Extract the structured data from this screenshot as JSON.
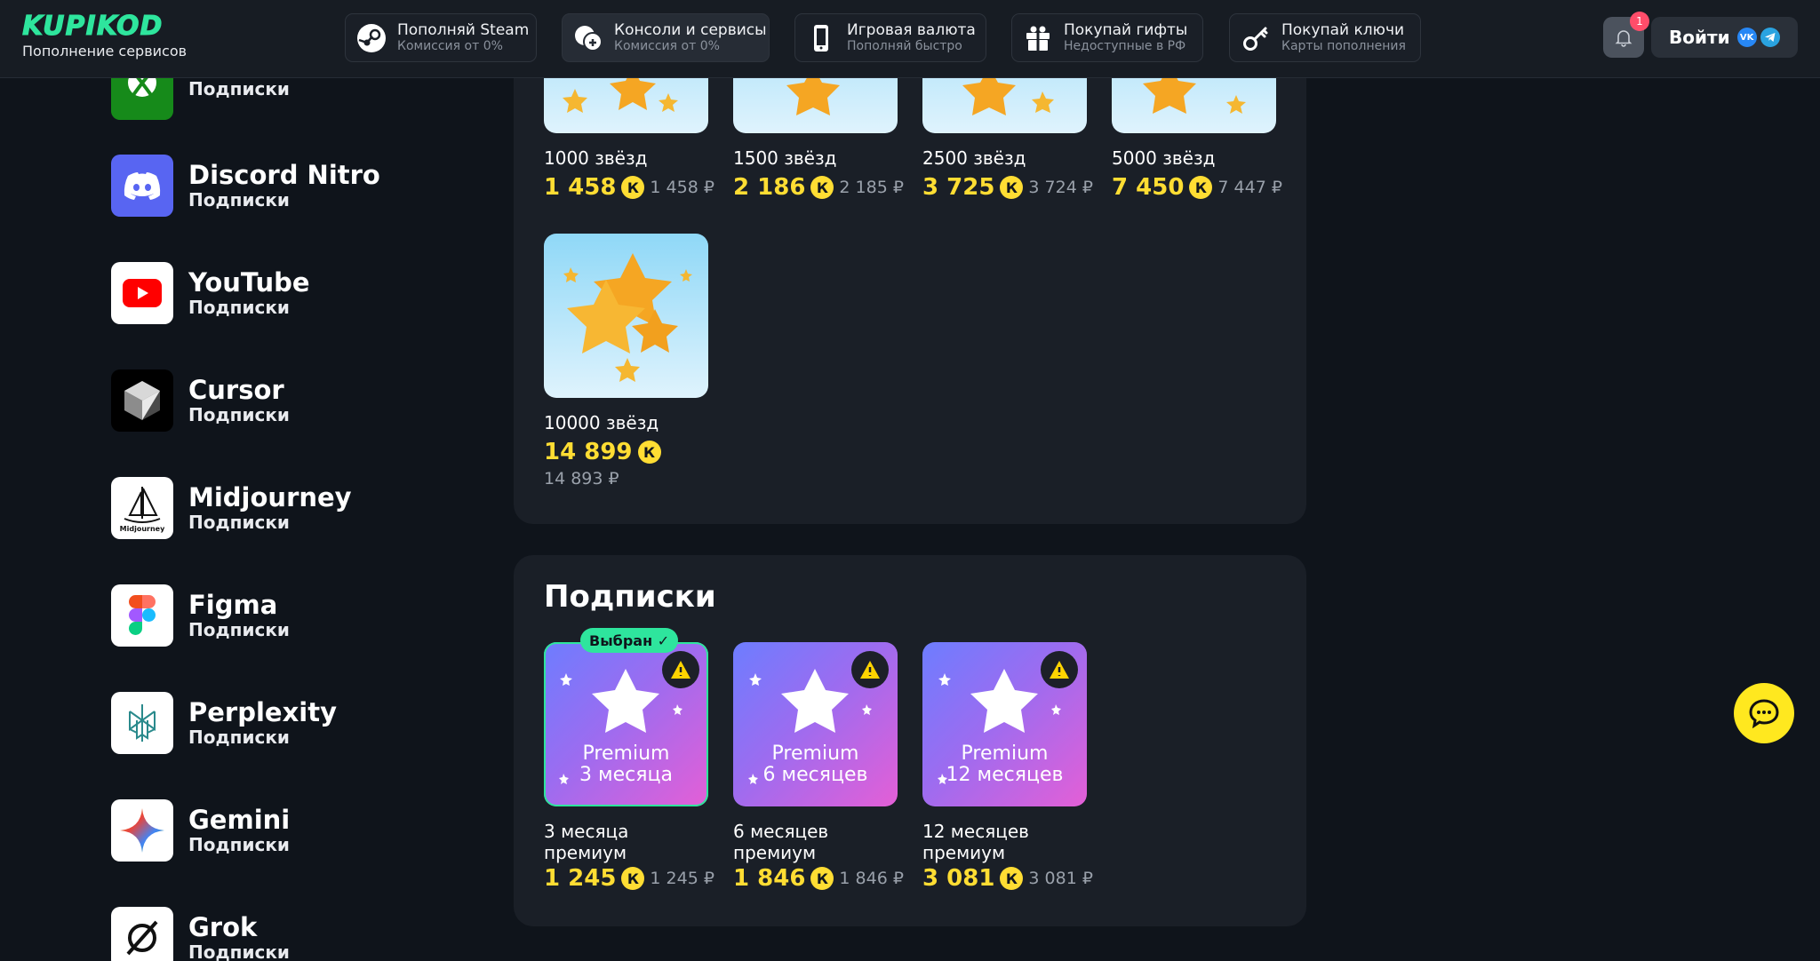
{
  "header": {
    "logo": "KUPIKOD",
    "logo_sub": "Пополнение сервисов",
    "nav": [
      {
        "title": "Пополняй Steam",
        "sub": "Комиссия от 0%",
        "icon": "steam-icon"
      },
      {
        "title": "Консоли и сервисы",
        "sub": "Комиссия от 0%",
        "icon": "console-icon"
      },
      {
        "title": "Игровая валюта",
        "sub": "Пополняй быстро",
        "icon": "phone-icon"
      },
      {
        "title": "Покупай гифты",
        "sub": "Недоступные в РФ",
        "icon": "gift-icon"
      },
      {
        "title": "Покупай ключи",
        "sub": "Карты пополнения",
        "icon": "key-icon"
      }
    ],
    "notifications": "1",
    "login_label": "Войти",
    "vk": "VK"
  },
  "sidebar": [
    {
      "title": "",
      "sub": "Подписки",
      "icon": "xbox-icon"
    },
    {
      "title": "Discord Nitro",
      "sub": "Подписки",
      "icon": "discord-icon"
    },
    {
      "title": "YouTube",
      "sub": "Подписки",
      "icon": "youtube-icon"
    },
    {
      "title": "Cursor",
      "sub": "Подписки",
      "icon": "cursor-icon"
    },
    {
      "title": "Midjourney",
      "sub": "Подписки",
      "icon": "midjourney-icon"
    },
    {
      "title": "Figma",
      "sub": "Подписки",
      "icon": "figma-icon"
    },
    {
      "title": "Perplexity",
      "sub": "Подписки",
      "icon": "perplexity-icon"
    },
    {
      "title": "Gemini",
      "sub": "Подписки",
      "icon": "gemini-icon"
    },
    {
      "title": "Grok",
      "sub": "Подписки",
      "icon": "grok-icon"
    }
  ],
  "stars": [
    {
      "name": "1000 звёзд",
      "price": "1 458",
      "rub": "1 458 ₽"
    },
    {
      "name": "1500 звёзд",
      "price": "2 186",
      "rub": "2 185 ₽"
    },
    {
      "name": "2500 звёзд",
      "price": "3 725",
      "rub": "3 724 ₽"
    },
    {
      "name": "5000 звёзд",
      "price": "7 450",
      "rub": "7 447 ₽"
    },
    {
      "name": "10000 звёзд",
      "price": "14 899",
      "rub": "14 893 ₽"
    }
  ],
  "coin_symbol": "К",
  "subscriptions": {
    "title": "Подписки",
    "chosen_label": "Выбран ✓",
    "items": [
      {
        "img_line1": "Premium",
        "img_line2": "3 месяца",
        "name_line1": "3 месяца",
        "name_line2": "премиум",
        "price": "1 245",
        "rub": "1 245 ₽"
      },
      {
        "img_line1": "Premium",
        "img_line2": "6 месяцев",
        "name_line1": "6 месяцев",
        "name_line2": "премиум",
        "price": "1 846",
        "rub": "1 846 ₽"
      },
      {
        "img_line1": "Premium",
        "img_line2": "12 месяцев",
        "name_line1": "12 месяцев",
        "name_line2": "премиум",
        "price": "3 081",
        "rub": "3 081 ₽"
      }
    ]
  },
  "colors": {
    "accent": "#2ee59d",
    "price": "#ffdd33",
    "bg": "#0f141b",
    "panel": "#1a1f27"
  }
}
